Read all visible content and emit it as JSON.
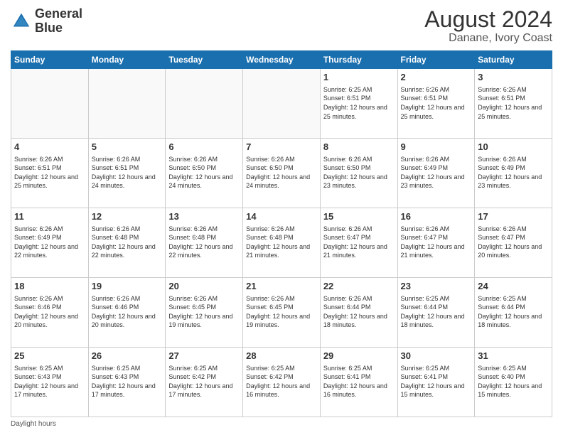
{
  "logo": {
    "line1": "General",
    "line2": "Blue"
  },
  "title": "August 2024",
  "subtitle": "Danane, Ivory Coast",
  "header": {
    "days": [
      "Sunday",
      "Monday",
      "Tuesday",
      "Wednesday",
      "Thursday",
      "Friday",
      "Saturday"
    ]
  },
  "footer": "Daylight hours",
  "weeks": [
    [
      {
        "day": "",
        "info": ""
      },
      {
        "day": "",
        "info": ""
      },
      {
        "day": "",
        "info": ""
      },
      {
        "day": "",
        "info": ""
      },
      {
        "day": "1",
        "info": "Sunrise: 6:25 AM\nSunset: 6:51 PM\nDaylight: 12 hours\nand 25 minutes."
      },
      {
        "day": "2",
        "info": "Sunrise: 6:26 AM\nSunset: 6:51 PM\nDaylight: 12 hours\nand 25 minutes."
      },
      {
        "day": "3",
        "info": "Sunrise: 6:26 AM\nSunset: 6:51 PM\nDaylight: 12 hours\nand 25 minutes."
      }
    ],
    [
      {
        "day": "4",
        "info": "Sunrise: 6:26 AM\nSunset: 6:51 PM\nDaylight: 12 hours\nand 25 minutes."
      },
      {
        "day": "5",
        "info": "Sunrise: 6:26 AM\nSunset: 6:51 PM\nDaylight: 12 hours\nand 24 minutes."
      },
      {
        "day": "6",
        "info": "Sunrise: 6:26 AM\nSunset: 6:50 PM\nDaylight: 12 hours\nand 24 minutes."
      },
      {
        "day": "7",
        "info": "Sunrise: 6:26 AM\nSunset: 6:50 PM\nDaylight: 12 hours\nand 24 minutes."
      },
      {
        "day": "8",
        "info": "Sunrise: 6:26 AM\nSunset: 6:50 PM\nDaylight: 12 hours\nand 23 minutes."
      },
      {
        "day": "9",
        "info": "Sunrise: 6:26 AM\nSunset: 6:49 PM\nDaylight: 12 hours\nand 23 minutes."
      },
      {
        "day": "10",
        "info": "Sunrise: 6:26 AM\nSunset: 6:49 PM\nDaylight: 12 hours\nand 23 minutes."
      }
    ],
    [
      {
        "day": "11",
        "info": "Sunrise: 6:26 AM\nSunset: 6:49 PM\nDaylight: 12 hours\nand 22 minutes."
      },
      {
        "day": "12",
        "info": "Sunrise: 6:26 AM\nSunset: 6:48 PM\nDaylight: 12 hours\nand 22 minutes."
      },
      {
        "day": "13",
        "info": "Sunrise: 6:26 AM\nSunset: 6:48 PM\nDaylight: 12 hours\nand 22 minutes."
      },
      {
        "day": "14",
        "info": "Sunrise: 6:26 AM\nSunset: 6:48 PM\nDaylight: 12 hours\nand 21 minutes."
      },
      {
        "day": "15",
        "info": "Sunrise: 6:26 AM\nSunset: 6:47 PM\nDaylight: 12 hours\nand 21 minutes."
      },
      {
        "day": "16",
        "info": "Sunrise: 6:26 AM\nSunset: 6:47 PM\nDaylight: 12 hours\nand 21 minutes."
      },
      {
        "day": "17",
        "info": "Sunrise: 6:26 AM\nSunset: 6:47 PM\nDaylight: 12 hours\nand 20 minutes."
      }
    ],
    [
      {
        "day": "18",
        "info": "Sunrise: 6:26 AM\nSunset: 6:46 PM\nDaylight: 12 hours\nand 20 minutes."
      },
      {
        "day": "19",
        "info": "Sunrise: 6:26 AM\nSunset: 6:46 PM\nDaylight: 12 hours\nand 20 minutes."
      },
      {
        "day": "20",
        "info": "Sunrise: 6:26 AM\nSunset: 6:45 PM\nDaylight: 12 hours\nand 19 minutes."
      },
      {
        "day": "21",
        "info": "Sunrise: 6:26 AM\nSunset: 6:45 PM\nDaylight: 12 hours\nand 19 minutes."
      },
      {
        "day": "22",
        "info": "Sunrise: 6:26 AM\nSunset: 6:44 PM\nDaylight: 12 hours\nand 18 minutes."
      },
      {
        "day": "23",
        "info": "Sunrise: 6:25 AM\nSunset: 6:44 PM\nDaylight: 12 hours\nand 18 minutes."
      },
      {
        "day": "24",
        "info": "Sunrise: 6:25 AM\nSunset: 6:44 PM\nDaylight: 12 hours\nand 18 minutes."
      }
    ],
    [
      {
        "day": "25",
        "info": "Sunrise: 6:25 AM\nSunset: 6:43 PM\nDaylight: 12 hours\nand 17 minutes."
      },
      {
        "day": "26",
        "info": "Sunrise: 6:25 AM\nSunset: 6:43 PM\nDaylight: 12 hours\nand 17 minutes."
      },
      {
        "day": "27",
        "info": "Sunrise: 6:25 AM\nSunset: 6:42 PM\nDaylight: 12 hours\nand 17 minutes."
      },
      {
        "day": "28",
        "info": "Sunrise: 6:25 AM\nSunset: 6:42 PM\nDaylight: 12 hours\nand 16 minutes."
      },
      {
        "day": "29",
        "info": "Sunrise: 6:25 AM\nSunset: 6:41 PM\nDaylight: 12 hours\nand 16 minutes."
      },
      {
        "day": "30",
        "info": "Sunrise: 6:25 AM\nSunset: 6:41 PM\nDaylight: 12 hours\nand 15 minutes."
      },
      {
        "day": "31",
        "info": "Sunrise: 6:25 AM\nSunset: 6:40 PM\nDaylight: 12 hours\nand 15 minutes."
      }
    ]
  ]
}
